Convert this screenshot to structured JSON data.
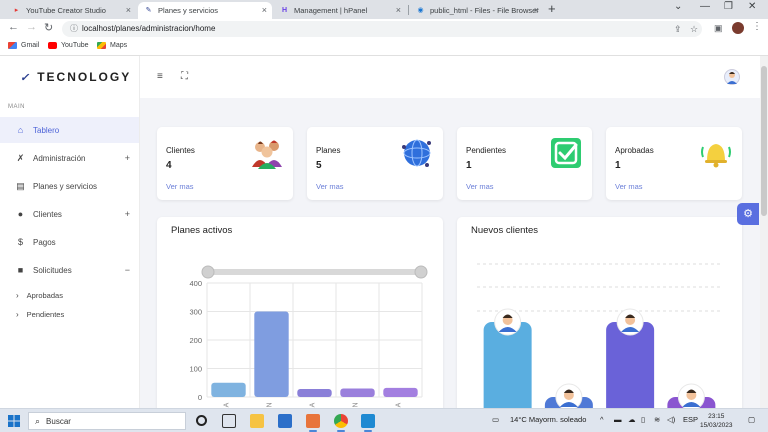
{
  "browser": {
    "tabs": [
      {
        "title": "YouTube Creator Studio"
      },
      {
        "title": "Planes y servicios"
      },
      {
        "title": "Management | hPanel"
      },
      {
        "title": "public_html - Files - File Browser"
      }
    ],
    "url": "localhost/planes/administracion/home",
    "bookmarks": [
      "Gmail",
      "YouTube",
      "Maps"
    ]
  },
  "app": {
    "brand": "TECNOLOGY",
    "section_label": "MAIN",
    "nav": [
      {
        "label": "Tablero",
        "icon": "home-icon",
        "active": true
      },
      {
        "label": "Administración",
        "icon": "tools-icon",
        "toggle": "+"
      },
      {
        "label": "Planes y servicios",
        "icon": "id-card-icon"
      },
      {
        "label": "Clientes",
        "icon": "users-icon",
        "toggle": "+"
      },
      {
        "label": "Pagos",
        "icon": "dollar-icon"
      },
      {
        "label": "Solicitudes",
        "icon": "truck-icon",
        "toggle": "−"
      }
    ],
    "subnav": [
      "Aprobadas",
      "Pendientes"
    ]
  },
  "stats": [
    {
      "title": "Clientes",
      "value": "4",
      "link": "Ver mas",
      "icon": "people-group-icon"
    },
    {
      "title": "Planes",
      "value": "5",
      "link": "Ver mas",
      "icon": "globe-icon"
    },
    {
      "title": "Pendientes",
      "value": "1",
      "link": "Ver mas",
      "icon": "check-badge-icon"
    },
    {
      "title": "Aprobadas",
      "value": "1",
      "link": "Ver mas",
      "icon": "bell-icon"
    }
  ],
  "panels": {
    "planes_activos": "Planes activos",
    "nuevos_clientes": "Nuevos clientes"
  },
  "chart_data": [
    {
      "type": "bar",
      "title": "Planes activos",
      "ylim": [
        0,
        400
      ],
      "yticks": [
        0,
        100,
        200,
        300,
        400
      ],
      "categories": [
        "A",
        "N",
        "A",
        "N",
        "A"
      ],
      "values": [
        50,
        300,
        28,
        30,
        32
      ],
      "colors": [
        "#7fb3e0",
        "#7f9de0",
        "#8a7fd8",
        "#9a7fdc",
        "#a37fe0"
      ],
      "grid": true
    },
    {
      "type": "bar",
      "title": "Nuevos clientes",
      "values": [
        3,
        0.5,
        3,
        0.5
      ],
      "colors": [
        "#5aaee0",
        "#4f79d6",
        "#6a62d8",
        "#8a55d0"
      ],
      "grid": true
    }
  ],
  "taskbar": {
    "search": "Buscar",
    "weather": "14°C  Mayorm. soleado",
    "lang": "ESP",
    "time": "23:15",
    "date": "15/03/2023"
  }
}
